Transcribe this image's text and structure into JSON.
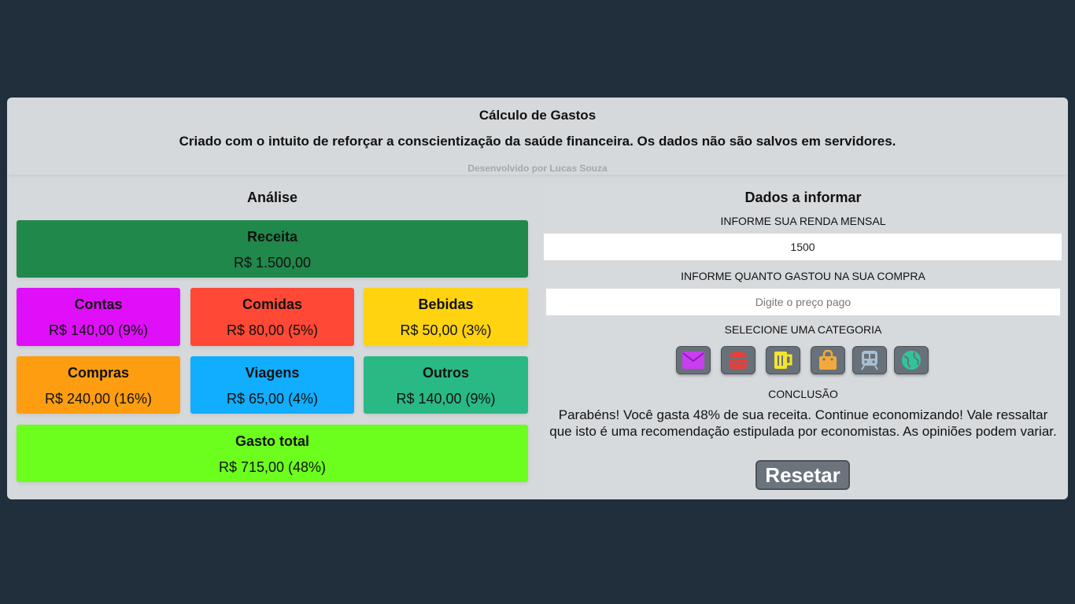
{
  "header": {
    "title": "Cálculo de Gastos",
    "subtitle": "Criado com o intuito de reforçar a conscientização da saúde financeira. Os dados não são salvos em servidores.",
    "credit": "Desenvolvido por Lucas Souza"
  },
  "analysis": {
    "title": "Análise",
    "receita": {
      "label": "Receita",
      "value": "R$ 1.500,00",
      "color": "#20884a"
    },
    "categories": [
      {
        "label": "Contas",
        "value": "R$ 140,00 (9%)",
        "color": "#df0ff9"
      },
      {
        "label": "Comidas",
        "value": "R$ 80,00 (5%)",
        "color": "#ff4936"
      },
      {
        "label": "Bebidas",
        "value": "R$ 50,00 (3%)",
        "color": "#ffd30f"
      },
      {
        "label": "Compras",
        "value": "R$ 240,00 (16%)",
        "color": "#ff9d10"
      },
      {
        "label": "Viagens",
        "value": "R$ 65,00 (4%)",
        "color": "#11adfe"
      },
      {
        "label": "Outros",
        "value": "R$ 140,00 (9%)",
        "color": "#28b985"
      }
    ],
    "total": {
      "label": "Gasto total",
      "value": "R$ 715,00 (48%)",
      "color": "#6cfe1d"
    }
  },
  "form": {
    "title": "Dados a informar",
    "income_label": "INFORME SUA RENDA MENSAL",
    "income_value": "1500",
    "expense_label": "INFORME QUANTO GASTOU NA SUA COMPRA",
    "expense_placeholder": "Digite o preço pago",
    "category_label": "SELECIONE UMA CATEGORIA",
    "category_icons": [
      "envelope-icon",
      "burger-icon",
      "beer-mug-icon",
      "shopping-bag-icon",
      "train-icon",
      "globe-icon"
    ],
    "conclusion_label": "CONCLUSÃO",
    "conclusion_text": "Parabéns! Você gasta 48% de sua receita. Continue economizando! Vale ressaltar que isto é uma recomendação estipulada por economistas. As opiniões podem variar.",
    "reset_label": "Resetar"
  }
}
